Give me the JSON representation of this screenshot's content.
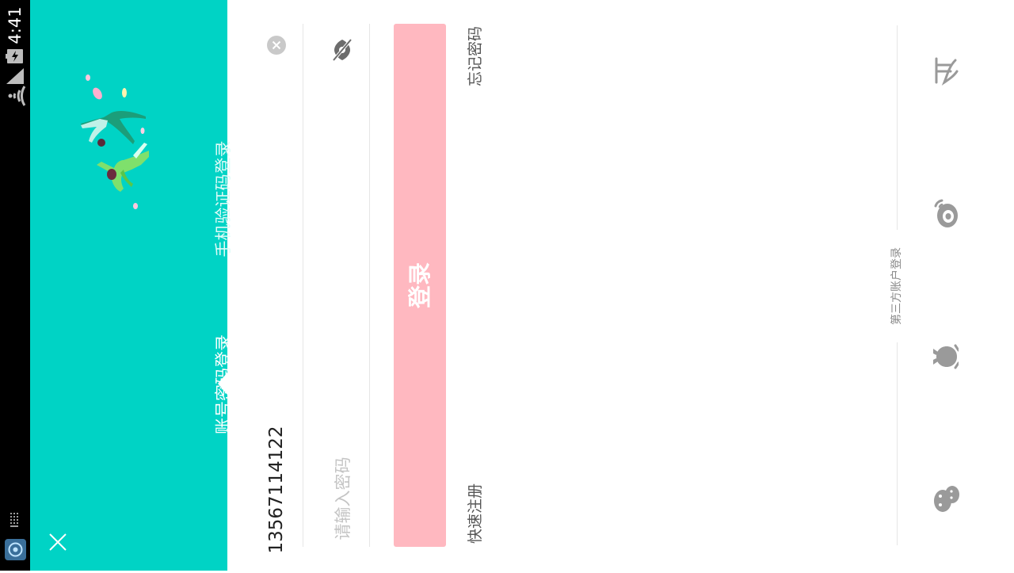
{
  "status_bar": {
    "time": "4:41"
  },
  "header": {
    "tabs": [
      {
        "label": "账号密码登录"
      },
      {
        "label": "手机验证码登录"
      }
    ]
  },
  "form": {
    "phone_value": "13567114122",
    "password_placeholder": "请输入密码",
    "login_label": "登录",
    "forgot_label": "忘记密码",
    "register_label": "快速注册"
  },
  "social": {
    "title": "第三方账户登录",
    "providers": [
      "alipay-icon",
      "weibo-icon",
      "qq-icon",
      "wechat-icon"
    ]
  },
  "colors": {
    "header_bg": "#00d3c5",
    "login_button_bg": "#ffb8c0",
    "social_icon": "#9a9a9a"
  }
}
